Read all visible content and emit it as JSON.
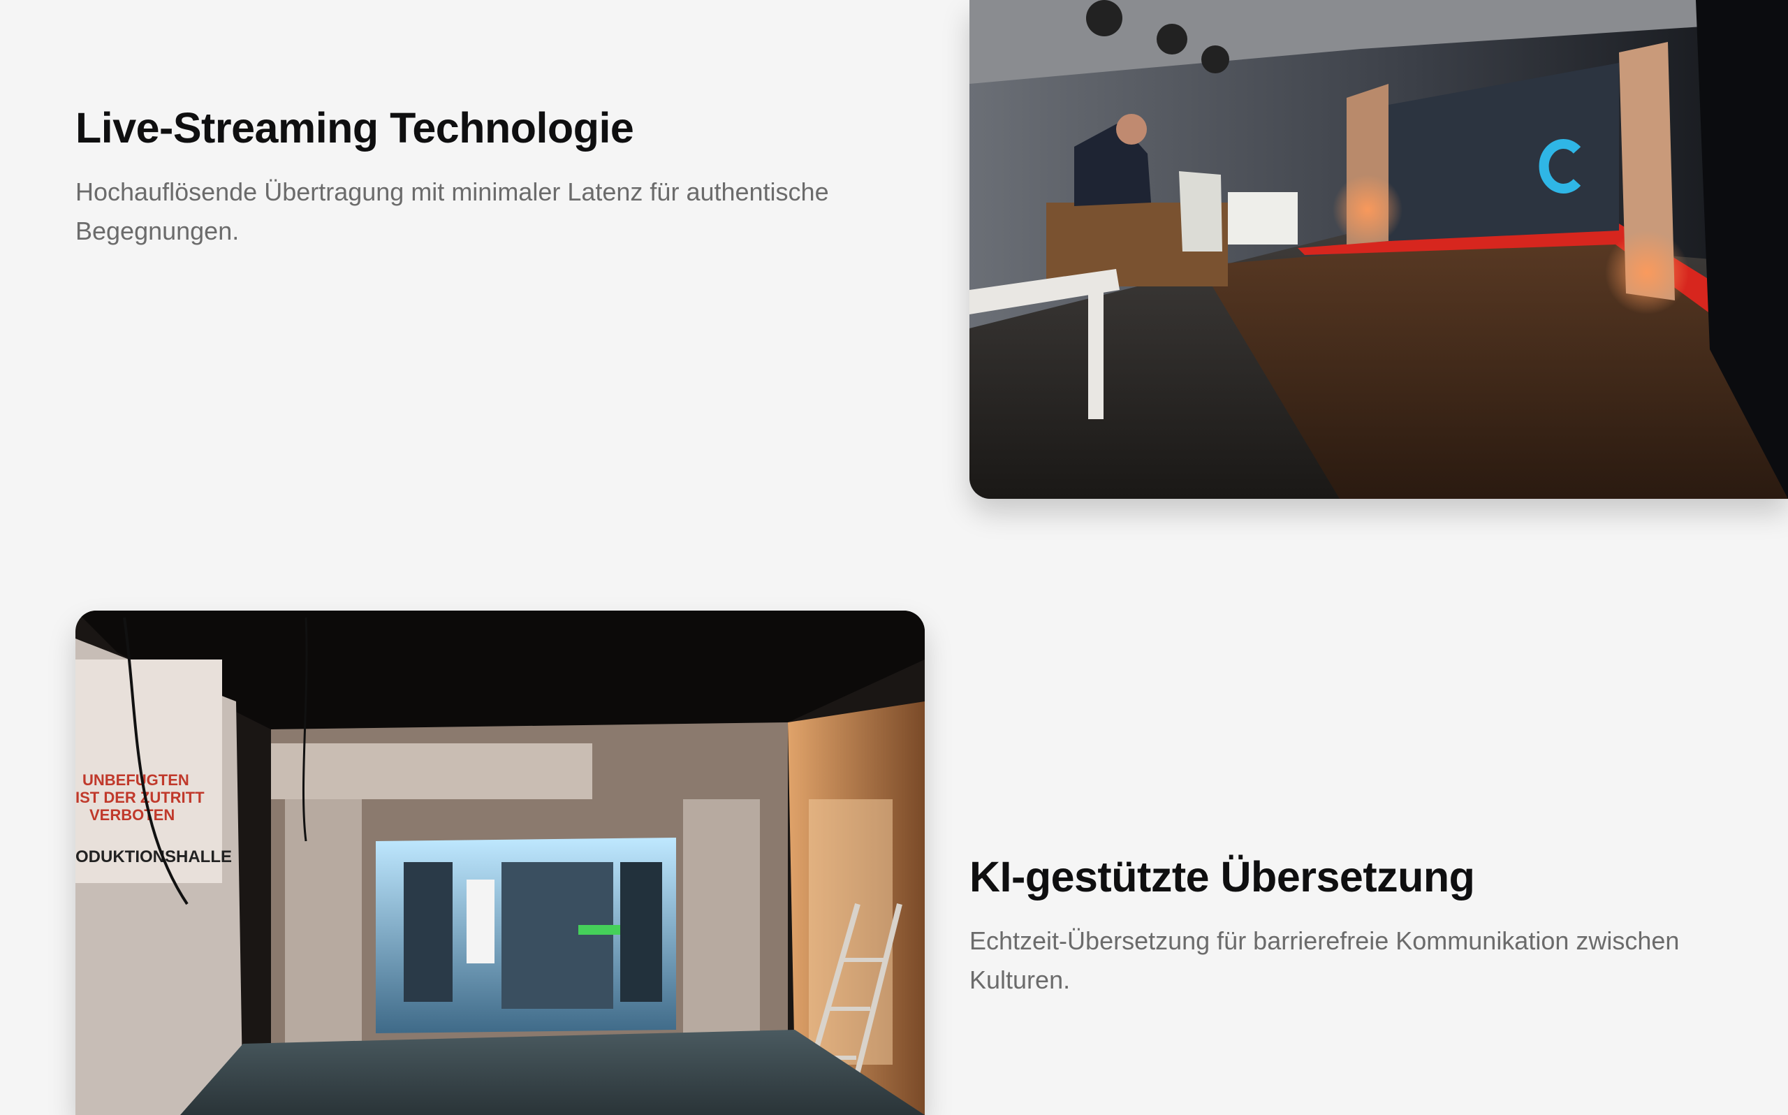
{
  "features": [
    {
      "title": "Live-Streaming Technologie",
      "description": "Hochauflösende Übertragung mit minimaler Latenz für authentische Begegnungen."
    },
    {
      "title": "KI-gestützte Übersetzung",
      "description": "Echtzeit-Übersetzung für barrierefreie Kommunikation zwischen Kulturen."
    }
  ],
  "photo_2_signage": {
    "warning_lines": [
      "UNBEFUGTEN",
      "IST DER ZUTRITT",
      "VERBOTEN"
    ],
    "hall_label": "ODUKTIONSHALLE"
  },
  "colors": {
    "background": "#f5f5f5",
    "heading": "#0f0f10",
    "body_text": "#6b6b6b",
    "projection_glow": "#2fb6e6",
    "stage_red": "#d7261e"
  }
}
